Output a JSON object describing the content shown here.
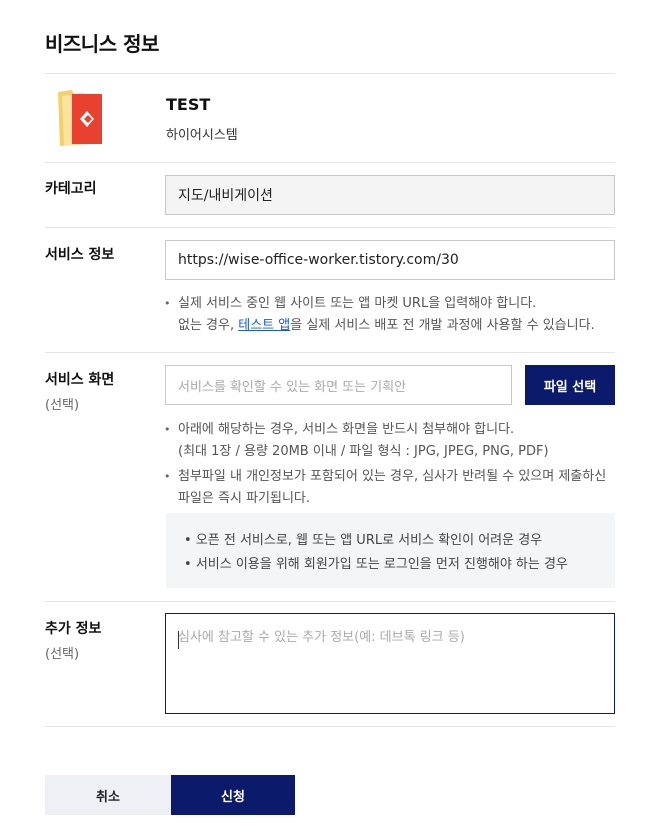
{
  "page": {
    "title": "비즈니스 정보"
  },
  "app": {
    "name": "TEST",
    "company": "하이어시스템"
  },
  "category": {
    "label": "카테고리",
    "value": "지도/내비게이션"
  },
  "service_info": {
    "label": "서비스 정보",
    "url_value": "https://wise-office-worker.tistory.com/30",
    "note_line1": "실제 서비스 중인 웹 사이트 또는 앱 마켓 URL을 입력해야 합니다.",
    "note_line2_prefix": "없는 경우, ",
    "note_link": "테스트 앱",
    "note_line2_suffix": "을 실제 서비스 배포 전 개발 과정에 사용할 수 있습니다."
  },
  "service_screen": {
    "label": "서비스 화면",
    "optional": "(선택)",
    "placeholder": "서비스를 확인할 수 있는 화면 또는 기획안",
    "file_button": "파일 선택",
    "note1_line1": "아래에 해당하는 경우, 서비스 화면을 반드시 첨부해야 합니다.",
    "note1_line2": "(최대 1장 / 용량 20MB 이내 / 파일 형식 : JPG, JPEG, PNG, PDF)",
    "note2_line1": "첨부파일 내 개인정보가 포함되어 있는 경우, 심사가 반려될 수 있으며 제출하신",
    "note2_line2": "파일은 즉시 파기됩니다.",
    "cases": [
      "오픈 전 서비스로, 웹 또는 앱 URL로 서비스 확인이 어려운 경우",
      "서비스 이용을 위해 회원가입 또는 로그인을 먼저 진행해야 하는 경우"
    ]
  },
  "extra_info": {
    "label": "추가 정보",
    "optional": "(선택)",
    "placeholder": "심사에 참고할 수 있는 추가 정보(예: 데브톡 링크 등)"
  },
  "actions": {
    "cancel": "취소",
    "apply": "신청"
  },
  "colors": {
    "primary": "#0c1a6b",
    "link": "#1a5ad6",
    "icon_red": "#e8412f",
    "icon_folder": "#f5cf6a"
  },
  "icons": {
    "app_icon": "folder-with-red-diamond-icon"
  }
}
